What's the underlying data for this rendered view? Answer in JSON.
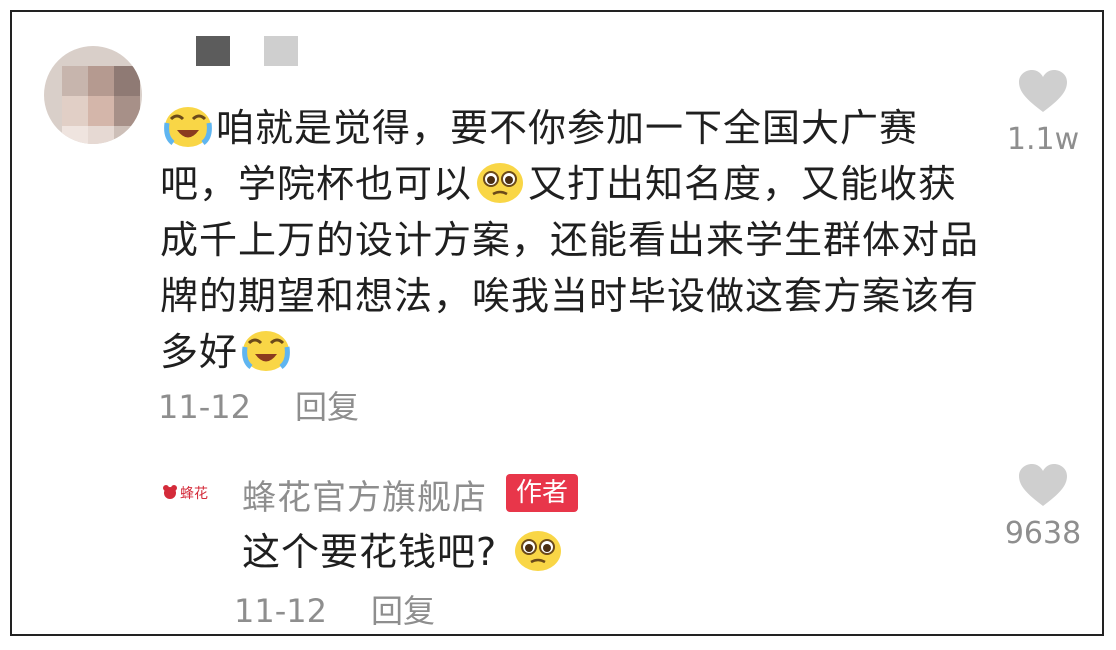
{
  "comment": {
    "segments": [
      "咱就是觉得，要不你参加一下全国大广赛吧，学院杯也可以",
      "又打出知名度，又能收获成千上万的设计方案，还能看出来学生群体对品牌的期望和想法，唉我当时毕设做这套方案该有多好"
    ],
    "date": "11-12",
    "reply_label": "回复",
    "likes": "1.1w"
  },
  "reply": {
    "shop_name": "蜂花官方旗舰店",
    "logo_text": "蜂花",
    "author_badge": "作者",
    "text": "这个要花钱吧?",
    "date": "11-12",
    "reply_label": "回复",
    "likes": "9638"
  },
  "icons": {
    "heart": "heart-icon",
    "crying_laugh": "crying-laughing-emoji-icon",
    "pleading": "pleading-face-emoji-icon"
  },
  "colors": {
    "author_badge": "#e8364a",
    "meta_text": "#8e8e8e",
    "heart": "#cfcfcf"
  }
}
